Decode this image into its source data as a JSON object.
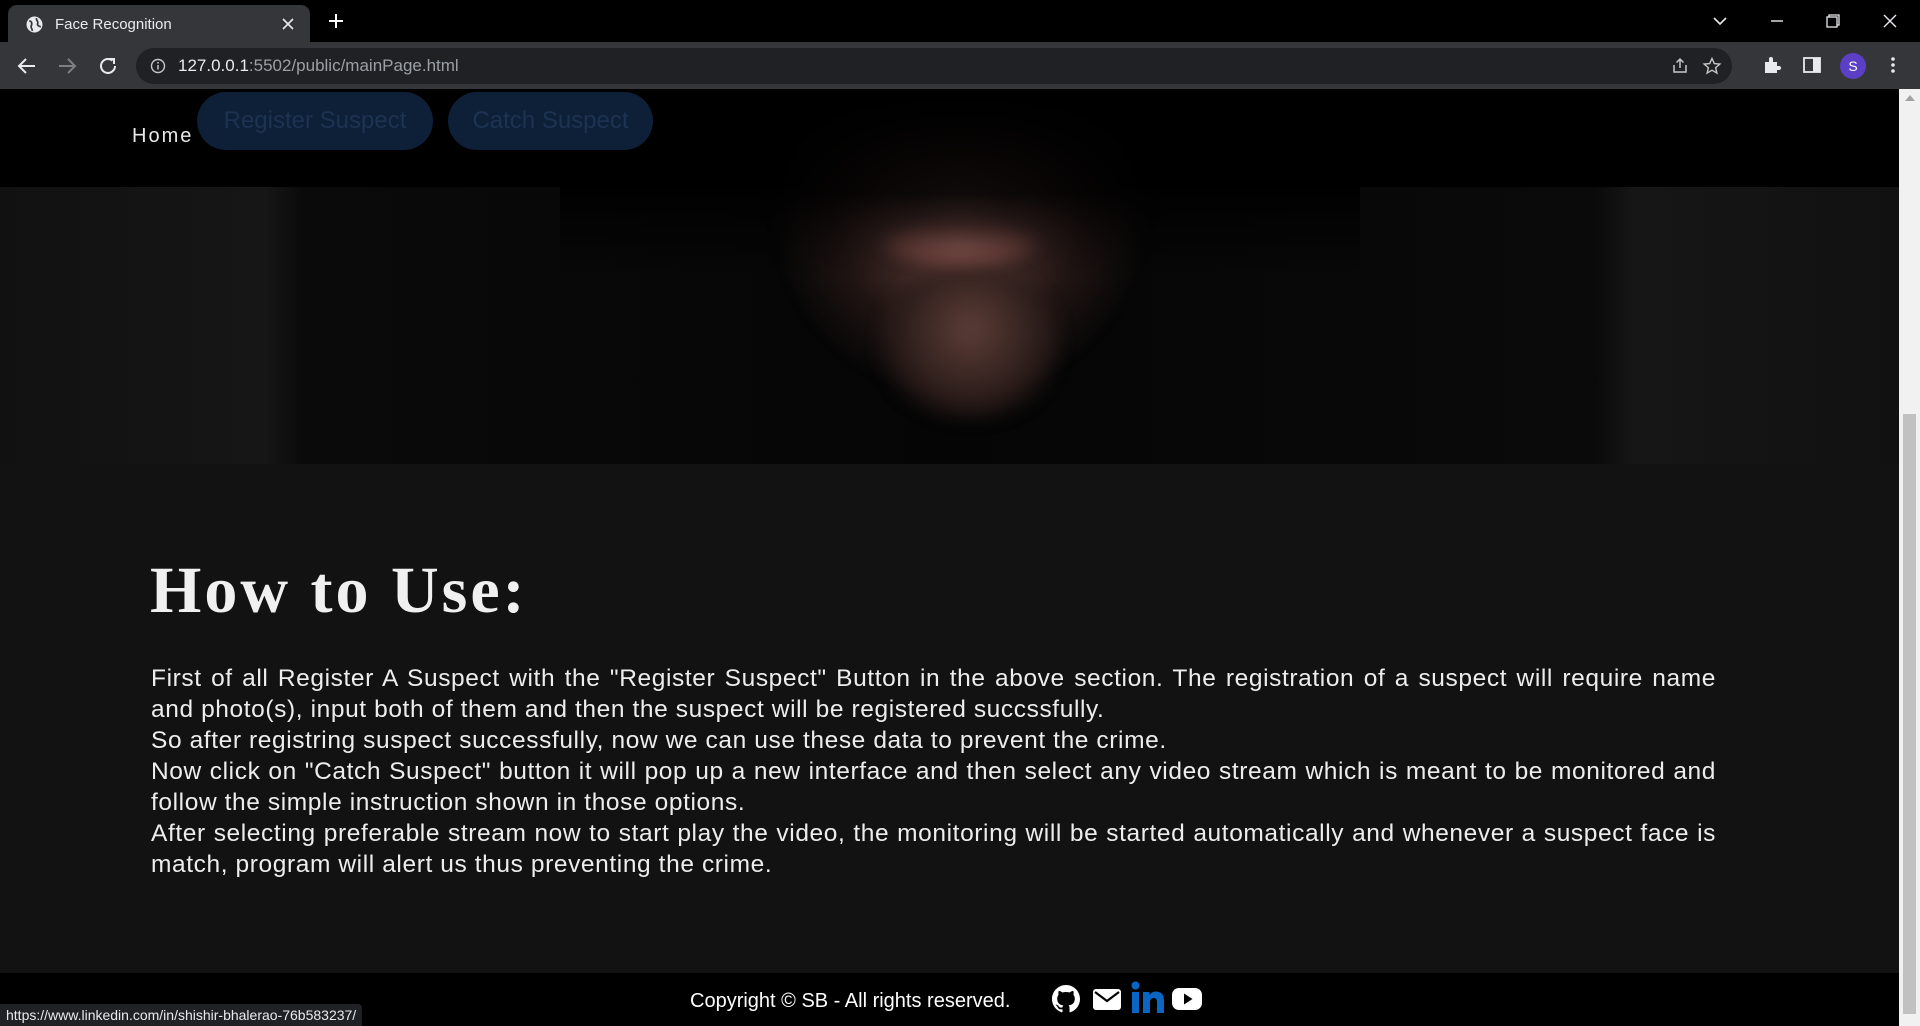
{
  "browser": {
    "tab_title": "Face Recognition",
    "url_host": "127.0.0.1",
    "url_path": ":5502/public/mainPage.html",
    "profile_initial": "S",
    "status_url": "https://www.linkedin.com/in/shishir-bhalerao-76b583237/"
  },
  "nav": {
    "home_label": "Home",
    "register_label": "Register Suspect",
    "catch_label": "Catch Suspect"
  },
  "howto": {
    "title": "How to Use:",
    "paragraphs": [
      "First of all Register A Suspect with the \"Register Suspect\" Button in the above section. The registration of a suspect will require name and photo(s), input both of them and then the suspect will be registered succssfully.",
      "So after registring suspect successfully, now we can use these data to prevent the crime.",
      "Now click on \"Catch Suspect\" button it will pop up a new interface and then select any video stream which is meant to be monitored and follow the simple instruction shown in those options.",
      "After selecting preferable stream now to start play the video, the monitoring will be started automatically and whenever a suspect face is match, program will alert us thus preventing the crime."
    ]
  },
  "footer": {
    "copyright": "Copyright © SB - All rights reserved.",
    "social_icons": [
      "github-icon",
      "mail-icon",
      "linkedin-icon",
      "youtube-icon"
    ]
  },
  "colors": {
    "page_bg": "#121212",
    "button_bg": "#0e1f38",
    "button_text": "#1d3352",
    "linkedin_blue": "#0a66c2"
  }
}
